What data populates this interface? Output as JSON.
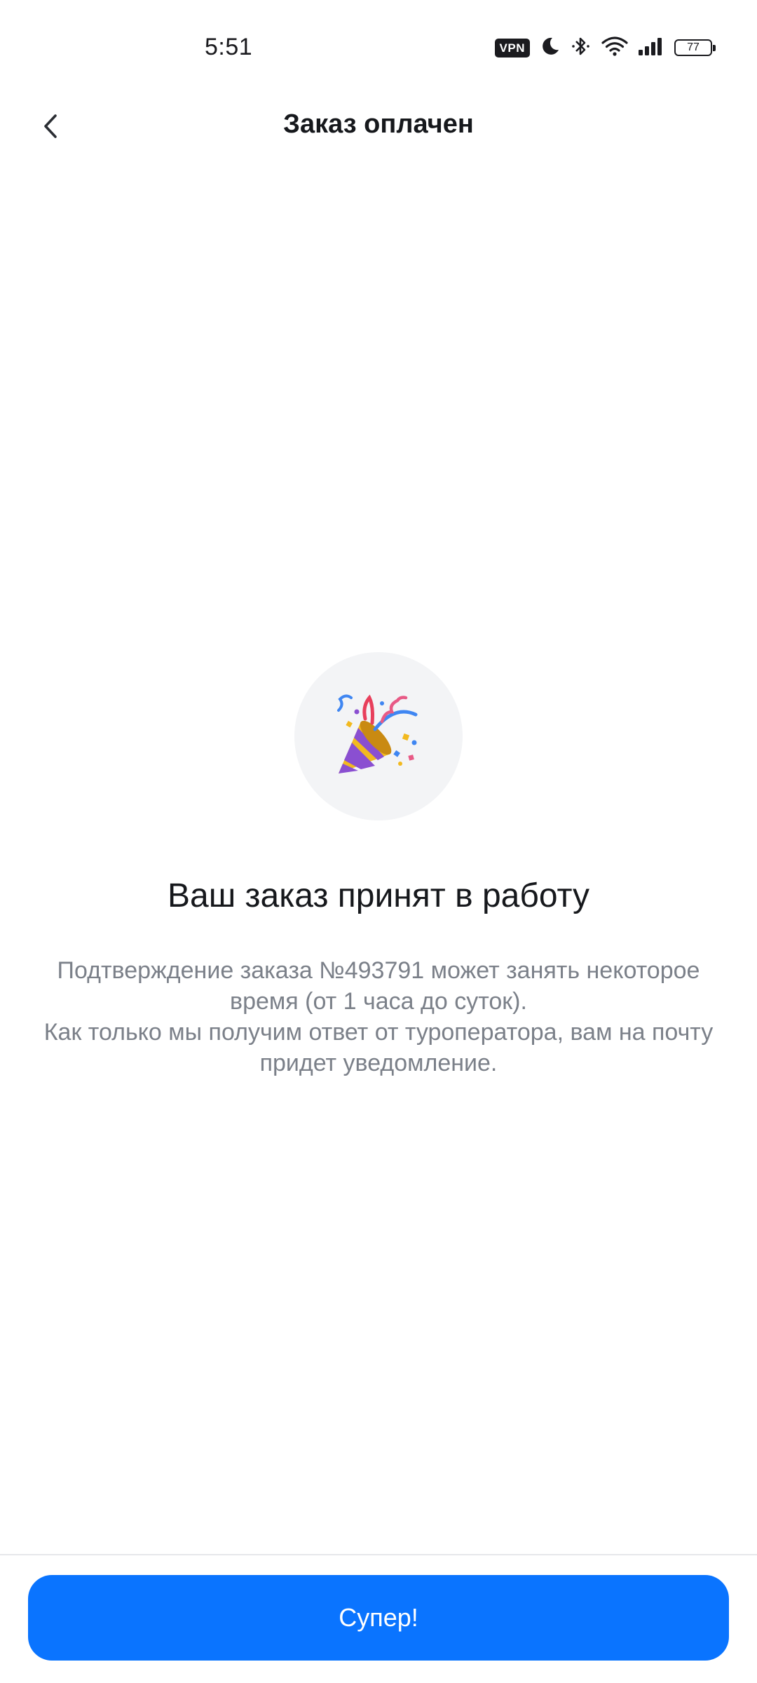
{
  "status_bar": {
    "time": "5:51",
    "vpn_label": "VPN",
    "battery_level": "77"
  },
  "header": {
    "title": "Заказ оплачен"
  },
  "confirmation": {
    "headline": "Ваш заказ принят в работу",
    "description_line1": "Подтверждение заказа №493791 может занять некоторое время (от 1 часа до суток).",
    "description_line2": "Как только мы получим ответ от туроператора, вам на почту придет уведомление."
  },
  "actions": {
    "primary_label": "Супер!"
  },
  "colors": {
    "accent": "#0a74ff",
    "muted_text": "#7b8089",
    "illustration_bg": "#f3f4f6"
  },
  "icons": {
    "back": "chevron-left-icon",
    "illustration": "party-popper-icon"
  }
}
